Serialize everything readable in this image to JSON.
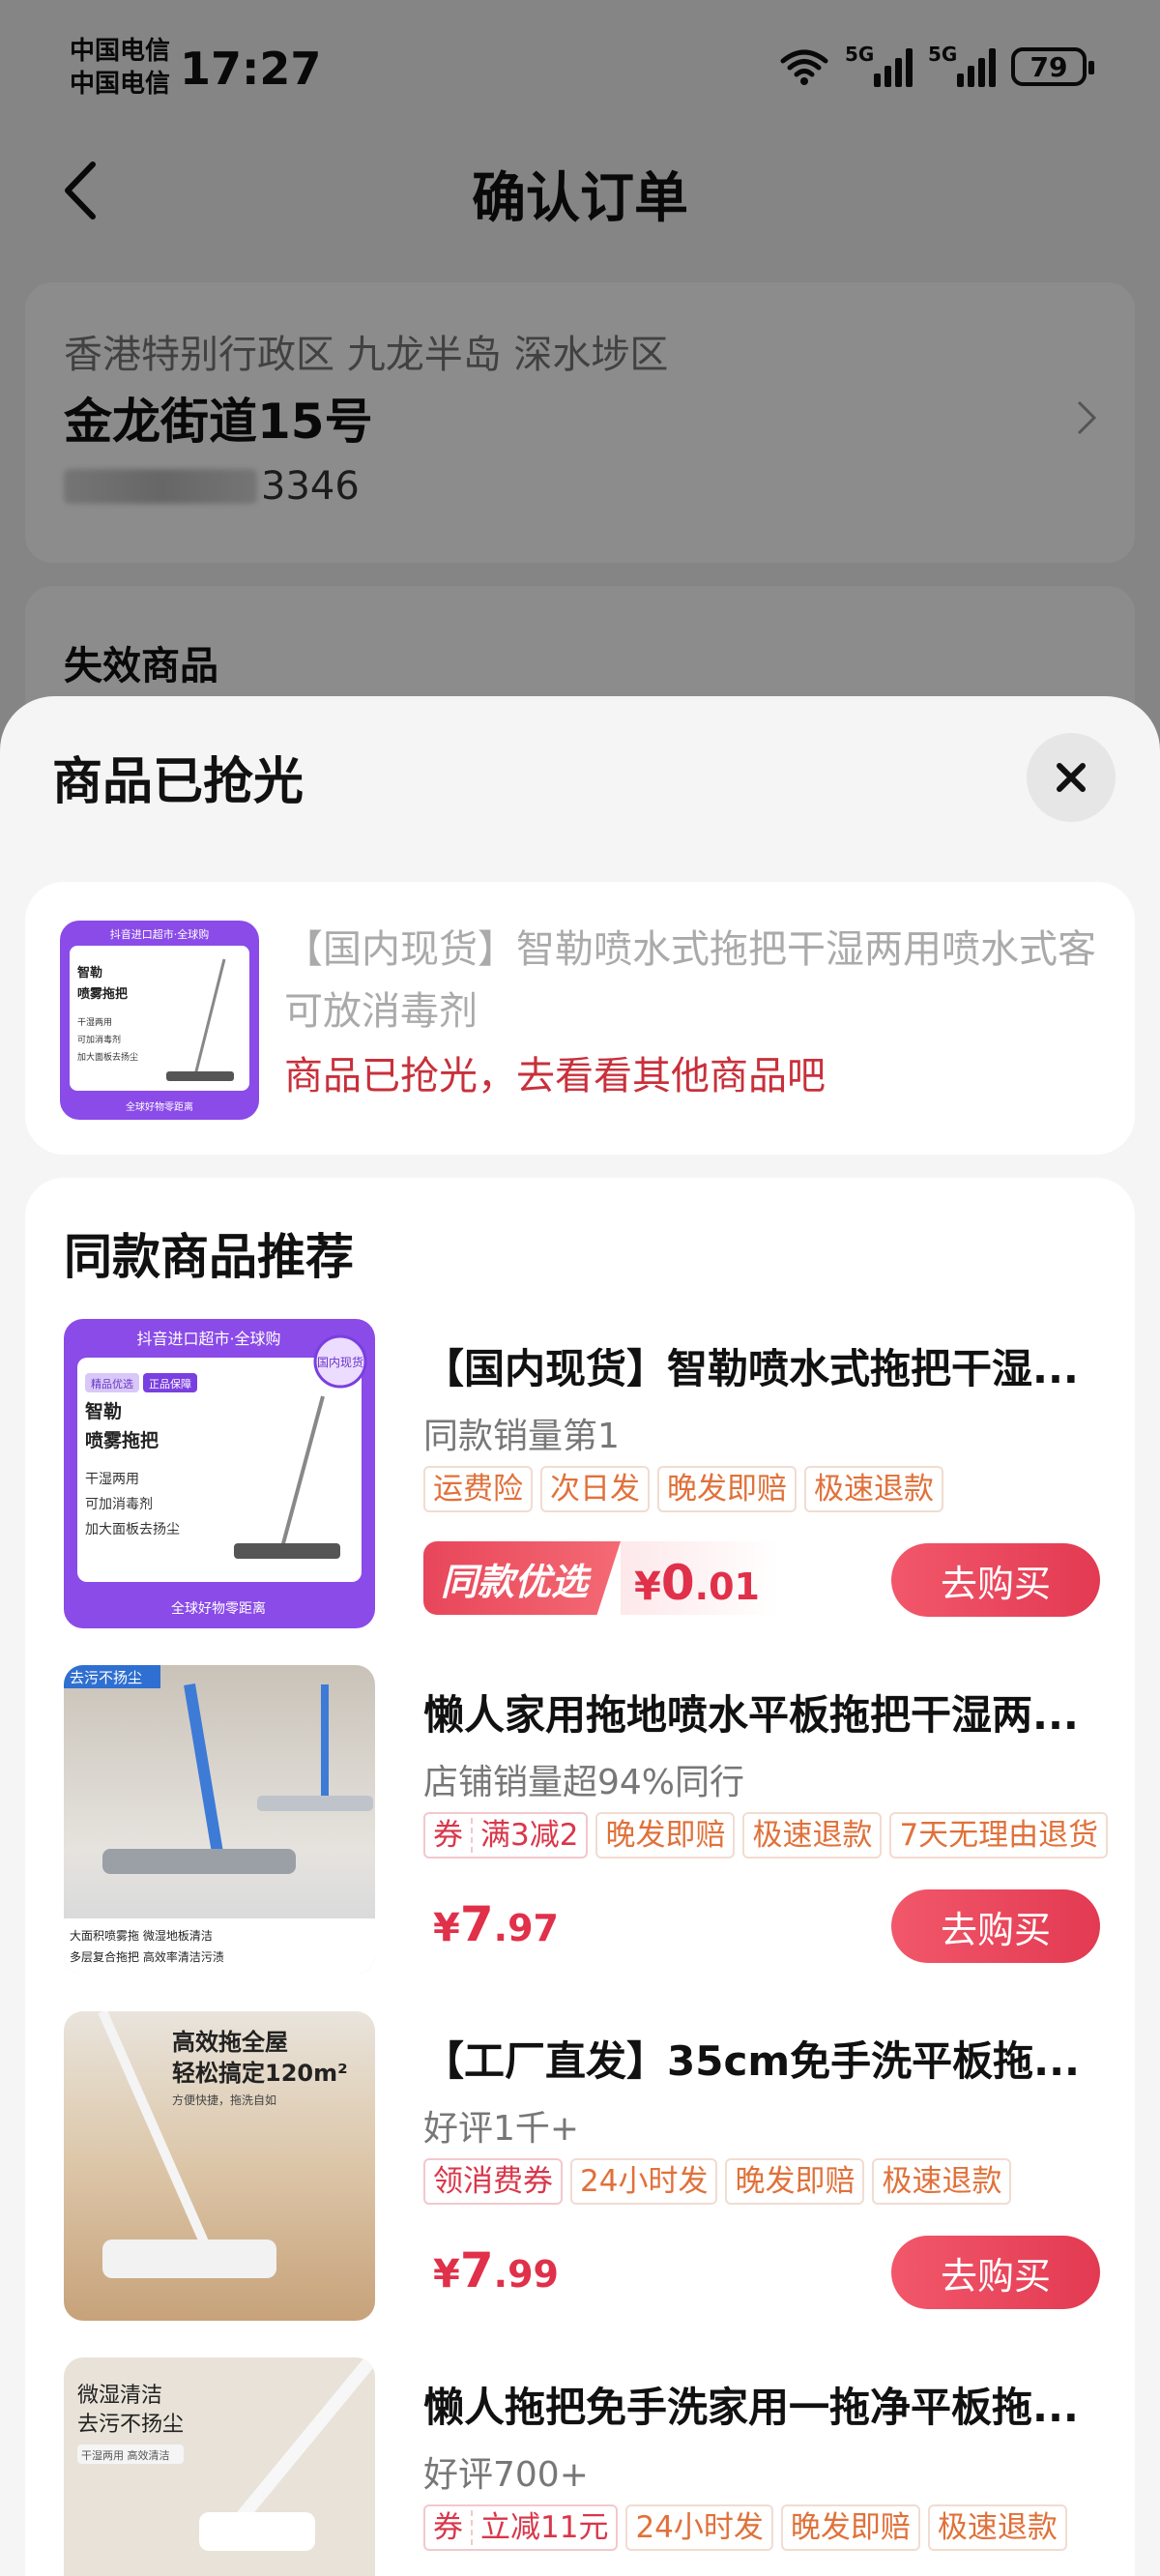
{
  "status_bar": {
    "carrier_1": "中国电信",
    "carrier_2": "中国电信",
    "time": "17:27",
    "net_1": "5G",
    "net_2": "5G",
    "battery": "79"
  },
  "nav": {
    "title": "确认订单"
  },
  "address": {
    "region": "香港特别行政区 九龙半岛 深水埗区",
    "street": "金龙街道15号",
    "phone_suffix": "3346"
  },
  "invalid_section": {
    "title": "失效商品"
  },
  "sheet": {
    "title": "商品已抢光",
    "soldout": {
      "name": "【国内现货】智勒喷水式拖把干湿两用喷水式客可放消毒剂",
      "tip": "商品已抢光，去看看其他商品吧",
      "thumb_header": "抖音进口超市·全球购",
      "thumb_lines": [
        "智勒",
        "喷雾拖把",
        "干湿两用",
        "可加消毒剂",
        "加大面板去扬尘"
      ],
      "thumb_footer": "全球好物零距离"
    },
    "recommend": {
      "title": "同款商品推荐",
      "buy_label": "去购买",
      "items": [
        {
          "name": "【国内现货】智勒喷水式拖把干湿...",
          "sub": "同款销量第1",
          "tags": [
            "运费险",
            "次日发",
            "晚发即赔",
            "极速退款"
          ],
          "badge": "同款优选",
          "price_cur": "¥",
          "price_int": "0",
          "price_dec": ".01",
          "thumb_header": "抖音进口超市·全球购",
          "thumb_chip1": "精品优选",
          "thumb_chip2": "正品保障",
          "thumb_lines": [
            "智勒",
            "喷雾拖把",
            "干湿两用",
            "可加消毒剂",
            "加大面板去扬尘"
          ],
          "thumb_footer": "全球好物零距离",
          "thumb_corner": "国内现货"
        },
        {
          "name": "懒人家用拖地喷水平板拖把干湿两...",
          "sub": "店铺销量超94%同行",
          "coupon_label": "券",
          "coupon_text": "满3减2",
          "tags": [
            "晚发即赔",
            "极速退款",
            "7天无理由退货"
          ],
          "price_cur": "¥",
          "price_int": "7",
          "price_dec": ".97",
          "thumb_header": "去污不扬尘",
          "thumb_footer_1": "大面积喷雾拖 微湿地板清洁",
          "thumb_footer_2": "多层复合拖把 高效率清洁污渍"
        },
        {
          "name": "【工厂直发】35cm免手洗平板拖...",
          "sub": "好评1千+",
          "coupon_solo": "领消费券",
          "tags": [
            "24小时发",
            "晚发即赔",
            "极速退款"
          ],
          "price_cur": "¥",
          "price_int": "7",
          "price_dec": ".99",
          "thumb_line_1": "高效拖全屋",
          "thumb_line_2": "轻松搞定120m²",
          "thumb_line_3": "方便快捷，拖洗自如"
        },
        {
          "name": "懒人拖把免手洗家用一拖净平板拖...",
          "sub": "好评700+",
          "coupon_label": "券",
          "coupon_text": "立减11元",
          "tags": [
            "24小时发",
            "晚发即赔",
            "极速退款"
          ],
          "thumb_line_1": "微湿清洁",
          "thumb_line_2": "去污不扬尘",
          "thumb_line_3": "干湿两用 高效清洁"
        }
      ]
    }
  },
  "colors": {
    "accent": "#e0304a",
    "tag_text": "#e0713a",
    "purple": "#7a3fe0"
  }
}
